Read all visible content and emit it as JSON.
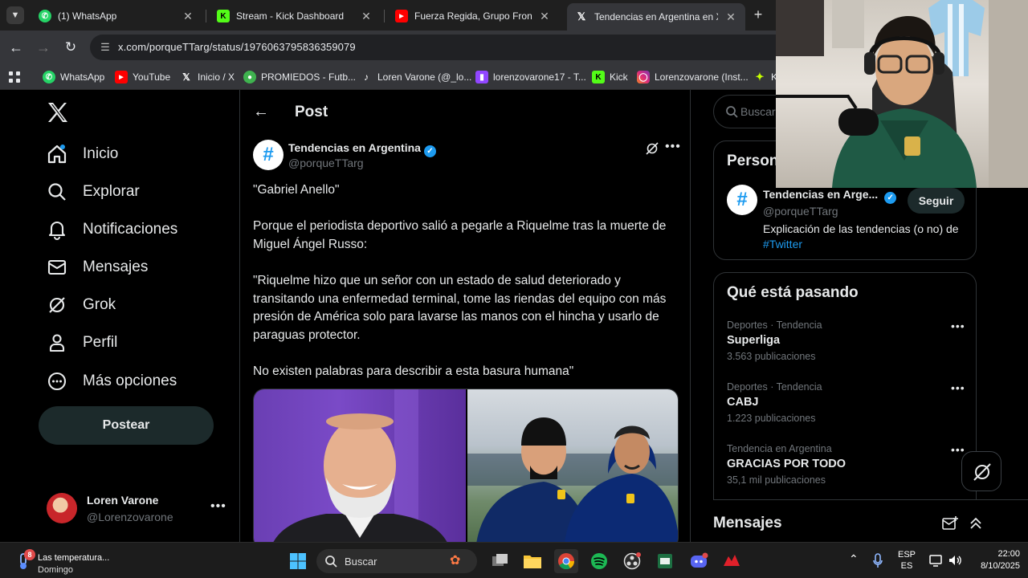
{
  "browser": {
    "tabs": [
      {
        "title": "(1) WhatsApp",
        "icon": "whatsapp-icon",
        "color": "#25d366"
      },
      {
        "title": "Stream - Kick Dashboard",
        "icon": "kick-icon",
        "color": "#53fc18"
      },
      {
        "title": "Fuerza Regida, Grupo Frontera",
        "icon": "youtube-icon",
        "color": "#ff0000"
      },
      {
        "title": "Tendencias en Argentina en X: \"",
        "icon": "x-icon",
        "color": "#ffffff",
        "active": true
      }
    ],
    "url": "x.com/porqueTTarg/status/1976063795836359079",
    "bookmarks": [
      {
        "label": "WhatsApp",
        "icon": "whatsapp-icon",
        "color": "#25d366"
      },
      {
        "label": "YouTube",
        "icon": "youtube-icon",
        "color": "#ff0000"
      },
      {
        "label": "Inicio / X",
        "icon": "x-icon",
        "color": "#ffffff"
      },
      {
        "label": "PROMIEDOS - Futb...",
        "icon": "promiedos-icon",
        "color": "#3fb34f"
      },
      {
        "label": "Loren Varone (@_lo...",
        "icon": "tiktok-icon",
        "color": "#ffffff"
      },
      {
        "label": "lorenzovarone17 - T...",
        "icon": "twitch-icon",
        "color": "#9146ff"
      },
      {
        "label": "Kick",
        "icon": "kick-icon",
        "color": "#53fc18"
      },
      {
        "label": "Lorenzovarone (Inst...",
        "icon": "instagram-icon",
        "color": "#e1306c"
      },
      {
        "label": "K",
        "icon": "kick-icon",
        "color": "#c6ff00"
      }
    ]
  },
  "sidebar": {
    "items": [
      {
        "label": "Inicio",
        "icon": "home-icon"
      },
      {
        "label": "Explorar",
        "icon": "search-icon"
      },
      {
        "label": "Notificaciones",
        "icon": "bell-icon"
      },
      {
        "label": "Mensajes",
        "icon": "mail-icon"
      },
      {
        "label": "Grok",
        "icon": "grok-icon"
      },
      {
        "label": "Perfil",
        "icon": "person-icon"
      },
      {
        "label": "Más opciones",
        "icon": "more-circle-icon"
      }
    ],
    "post_button": "Postear",
    "account": {
      "name": "Loren Varone",
      "handle": "@Lorenzovarone"
    }
  },
  "post": {
    "header": "Post",
    "author_name": "Tendencias en Argentina",
    "author_handle": "@porqueTTarg",
    "avatar_glyph": "#",
    "paragraphs": [
      "\"Gabriel Anello\"",
      "Porque el periodista deportivo salió a pegarle a Riquelme tras la muerte de Miguel Ángel Russo:",
      "\"Riquelme hizo que un señor con un estado de salud deteriorado y transitando una enfermedad terminal, tome las riendas del equipo con más presión de América solo para lavarse las manos con el hincha y usarlo de paraguas protector.",
      "No existen palabras para describir a esta basura humana\""
    ]
  },
  "right": {
    "search_placeholder": "Buscar",
    "who_to_follow": {
      "title": "Person",
      "name": "Tendencias en Arge...",
      "handle": "@porqueTTarg",
      "follow": "Seguir",
      "bio": "Explicación de las tendencias (o no) de",
      "bio_link": "#Twitter"
    },
    "trends": {
      "title": "Qué está pasando",
      "items": [
        {
          "meta": "Deportes · Tendencia",
          "name": "Superliga",
          "count": "3.563 publicaciones"
        },
        {
          "meta": "Deportes · Tendencia",
          "name": "CABJ",
          "count": "1.223 publicaciones"
        },
        {
          "meta": "Tendencia en Argentina",
          "name": "GRACIAS POR TODO",
          "count": "35,1 mil publicaciones"
        }
      ]
    },
    "messages_title": "Mensajes"
  },
  "taskbar": {
    "weather_title": "Las temperatura...",
    "weather_sub": "Domingo",
    "weather_badge": "8",
    "search": "Buscar",
    "lang1": "ESP",
    "lang2": "ES",
    "time": "22:00",
    "date": "8/10/2025"
  },
  "colors": {
    "accent": "#1d9bf0",
    "bg": "#000000",
    "border": "#2f3336",
    "muted": "#71767b"
  }
}
